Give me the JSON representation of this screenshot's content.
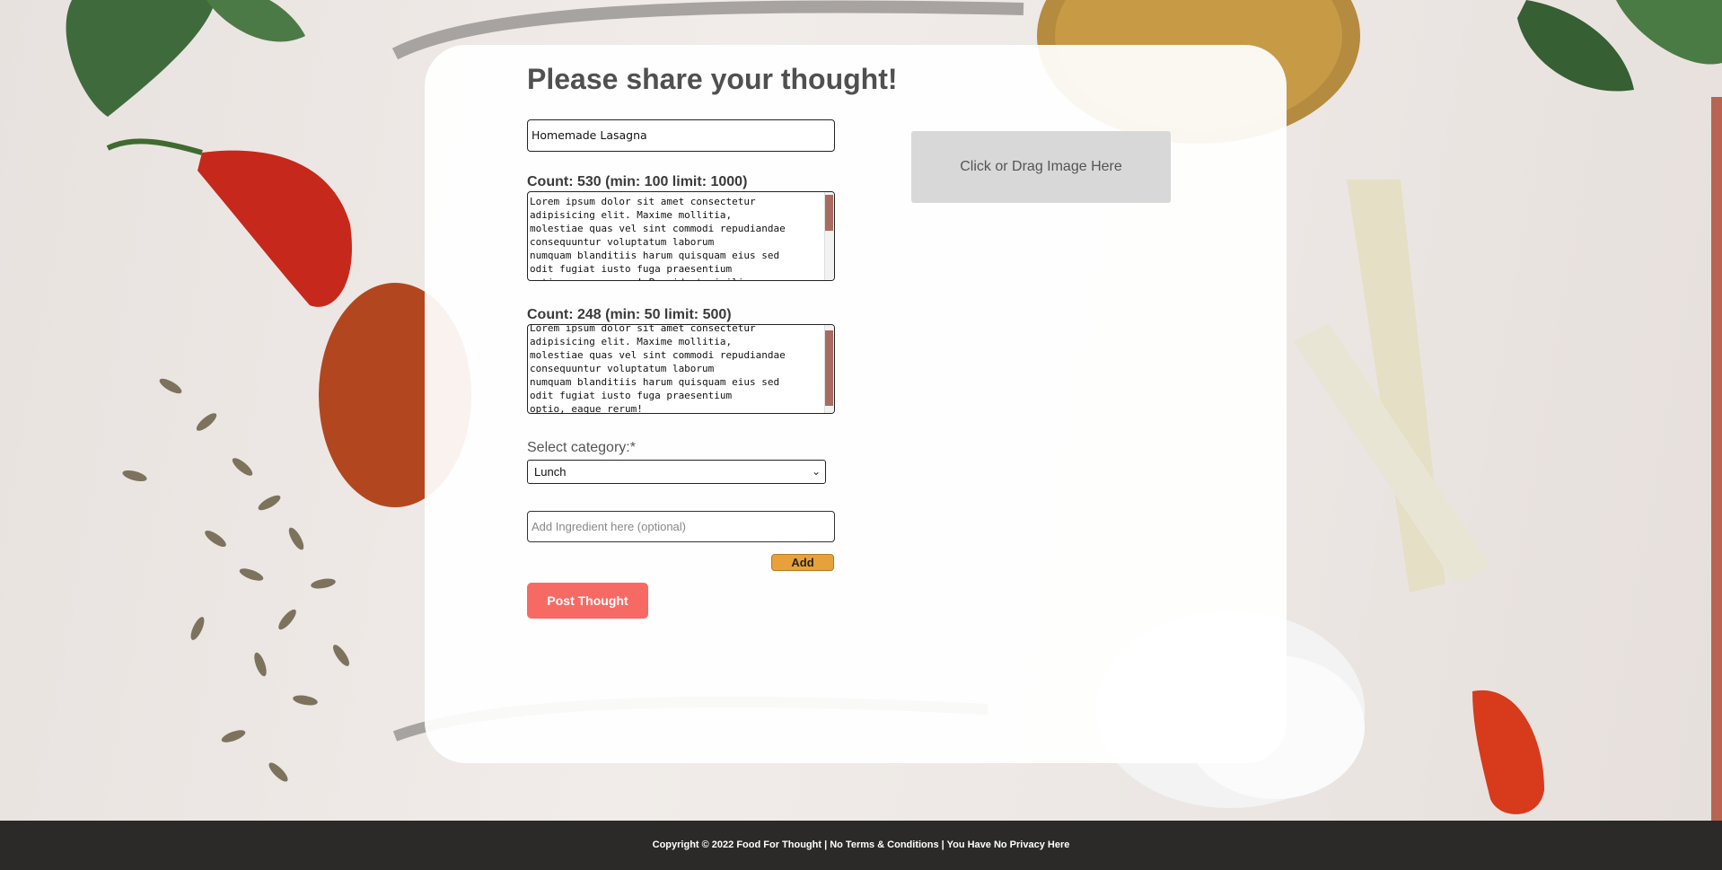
{
  "form": {
    "title": "Please share your thought!",
    "name_value": "Homemade Lasagna",
    "textarea1": {
      "count_label": "Count: 530 (min: 100 limit: 1000)",
      "text": "Lorem ipsum dolor sit amet consectetur\nadipisicing elit. Maxime mollitia,\nmolestiae quas vel sint commodi repudiandae\nconsequuntur voluptatum laborum\nnumquam blanditiis harum quisquam eius sed\nodit fugiat iusto fuga praesentium\noptio, eaque rerum! Provident similique"
    },
    "textarea2": {
      "count_label": "Count: 248 (min: 50 limit: 500)",
      "text": "Lorem ipsum dolor sit amet consectetur\nadipisicing elit. Maxime mollitia,\nmolestiae quas vel sint commodi repudiandae\nconsequuntur voluptatum laborum\nnumquam blanditiis harum quisquam eius sed\nodit fugiat iusto fuga praesentium\noptio, eaque rerum!"
    },
    "category_label": "Select category:*",
    "category_selected": "Lunch",
    "ingredient_placeholder": "Add Ingredient here (optional)",
    "add_label": "Add",
    "post_label": "Post Thought",
    "dropzone_label": "Click or Drag Image Here"
  },
  "footer": {
    "text": "Copyright © 2022 Food For Thought | No Terms & Conditions | You Have No Privacy Here"
  },
  "colors": {
    "accent": "#f76a64",
    "add_button": "#e8a13a",
    "footer_bg": "#2b2a29"
  }
}
